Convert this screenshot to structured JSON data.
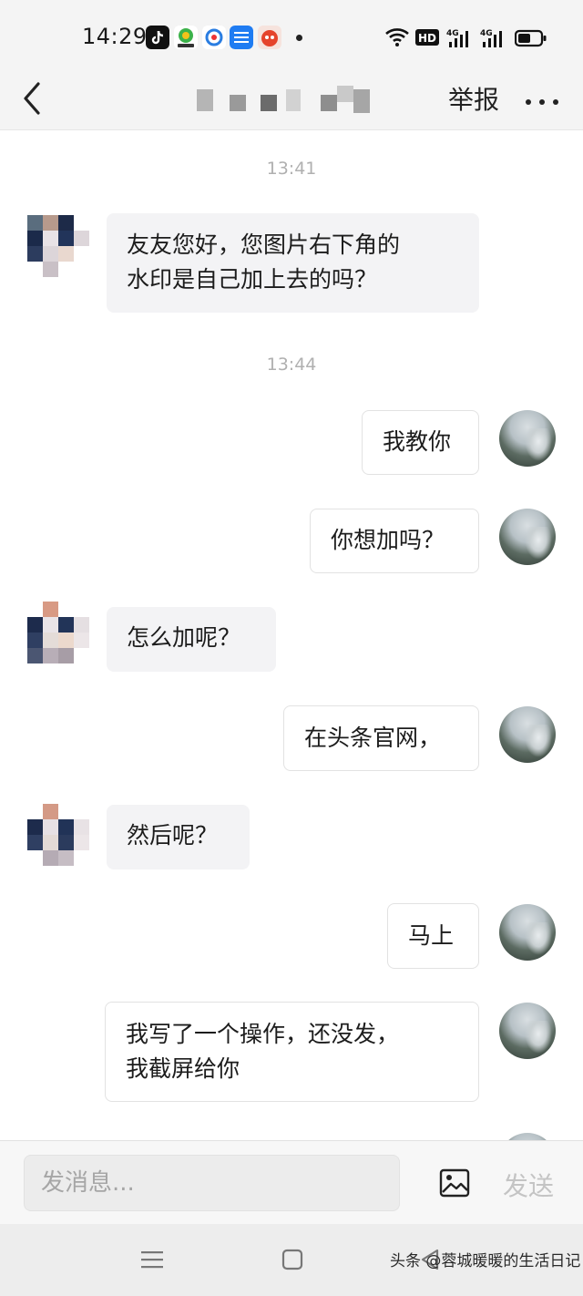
{
  "status_bar": {
    "time": "14:29",
    "icons": [
      "douyin-icon",
      "app-icon-green",
      "app-icon-ring",
      "zhihu-icon",
      "app-icon-red",
      "notification-dot",
      "wifi-icon",
      "hd-icon",
      "signal-4g-icon",
      "signal-4g-icon",
      "battery-icon"
    ],
    "hd_label": "HD",
    "network_label": "4G"
  },
  "header": {
    "title": "",
    "report_label": "举报",
    "more_icon": "more-icon",
    "back_icon": "back-icon"
  },
  "chat": {
    "messages": [
      {
        "type": "timestamp",
        "text": "13:41"
      },
      {
        "type": "incoming",
        "lines": [
          "友友您好，您图片右下角的",
          "水印是自己加上去的吗？"
        ]
      },
      {
        "type": "timestamp",
        "text": "13:44"
      },
      {
        "type": "outgoing",
        "lines": [
          "我教你"
        ]
      },
      {
        "type": "outgoing",
        "lines": [
          "你想加吗？"
        ]
      },
      {
        "type": "incoming",
        "lines": [
          "怎么加呢？"
        ]
      },
      {
        "type": "outgoing",
        "lines": [
          "在头条官网，"
        ]
      },
      {
        "type": "incoming",
        "lines": [
          "然后呢？"
        ]
      },
      {
        "type": "outgoing",
        "lines": [
          "马上"
        ]
      },
      {
        "type": "outgoing",
        "lines": [
          "我写了一个操作，还没发，",
          "我截屏给你"
        ]
      }
    ]
  },
  "input_bar": {
    "placeholder": "发消息...",
    "image_icon": "image-icon",
    "send_label": "发送"
  },
  "nav_bar": {
    "icons": [
      "menu-icon",
      "home-square-icon",
      "back-triangle-icon"
    ]
  },
  "watermark": {
    "text": "头条 @蓉城暖暖的生活日记"
  },
  "colors": {
    "background": "#f4f4f4",
    "chat_background": "#ffffff",
    "incoming_bubble": "#f3f3f5",
    "outgoing_bubble": "#ffffff",
    "timestamp": "#b0b0b0",
    "send_disabled": "#c4c4c4"
  }
}
